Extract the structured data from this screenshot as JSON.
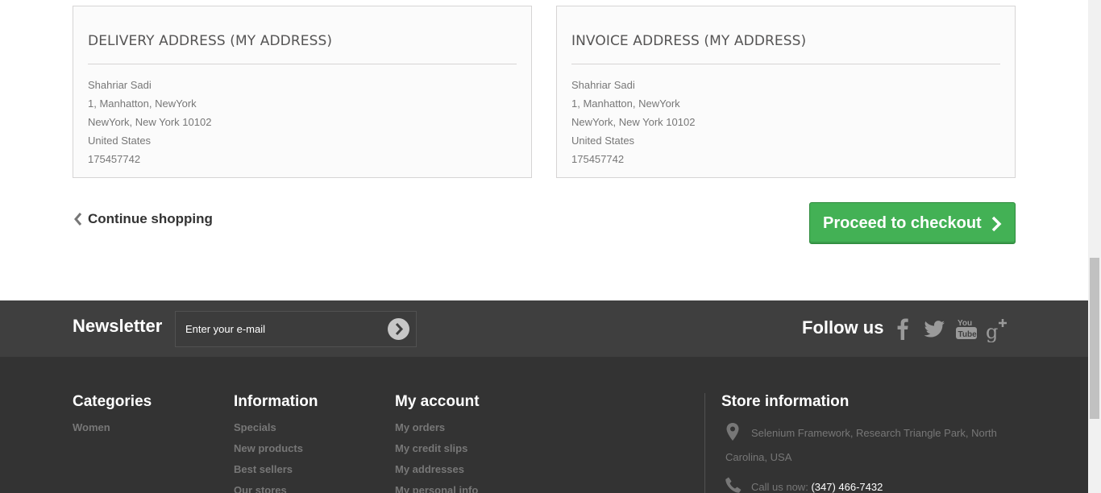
{
  "delivery_address": {
    "title": "DELIVERY ADDRESS (MY ADDRESS)",
    "lines": [
      "Shahriar Sadi",
      "1, Manhatton, NewYork",
      "NewYork, New York 10102",
      "United States",
      "175457742"
    ]
  },
  "invoice_address": {
    "title": "INVOICE ADDRESS (MY ADDRESS)",
    "lines": [
      "Shahriar Sadi",
      "1, Manhatton, NewYork",
      "NewYork, New York 10102",
      "United States",
      "175457742"
    ]
  },
  "navigation": {
    "continue_label": "Continue shopping",
    "checkout_label": "Proceed to checkout",
    "checkout_color": "#43b155"
  },
  "newsletter": {
    "title": "Newsletter",
    "placeholder": "Enter your e-mail",
    "submit_icon": "chevron-right-circle-icon"
  },
  "social": {
    "title": "Follow us",
    "icons": [
      "facebook-icon",
      "twitter-icon",
      "youtube-icon",
      "google-plus-icon"
    ]
  },
  "footer": {
    "categories": {
      "title": "Categories",
      "links": [
        "Women"
      ]
    },
    "information": {
      "title": "Information",
      "links": [
        "Specials",
        "New products",
        "Best sellers",
        "Our stores"
      ]
    },
    "my_account": {
      "title": "My account",
      "links": [
        "My orders",
        "My credit slips",
        "My addresses",
        "My personal info"
      ]
    },
    "store": {
      "title": "Store information",
      "address_line1": "Selenium Framework, Research Triangle Park, North",
      "address_line2": "Carolina, USA",
      "phone_label": "Call us now:",
      "phone_value": "(347) 466-7432"
    }
  },
  "colors": {
    "footer_bg": "#333333",
    "newsletter_bg": "#3f3f3f"
  }
}
